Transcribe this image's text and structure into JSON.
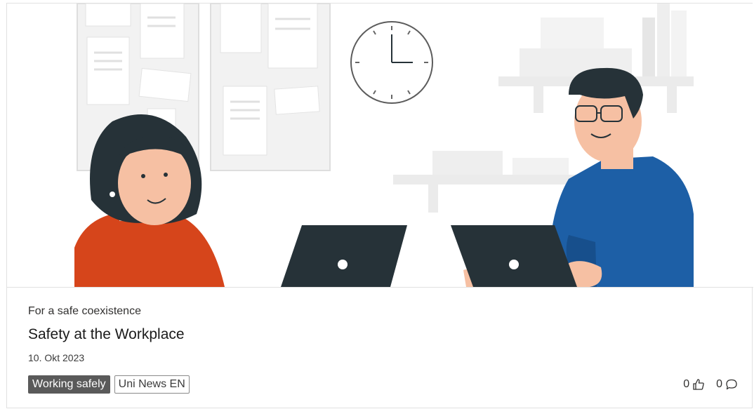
{
  "card": {
    "subtitle": "For a safe coexistence",
    "title": "Safety at the Workplace",
    "date": "10. Okt 2023",
    "tags": [
      "Working safely",
      "Uni News EN"
    ],
    "likes": {
      "count": "0",
      "icon": "thumbs-up-icon"
    },
    "comments": {
      "count": "0",
      "icon": "comment-icon"
    }
  },
  "illustration": {
    "colors": {
      "woman_sweater": "#d6451b",
      "man_shirt": "#1d5fa6",
      "laptop": "#263238",
      "skin": "#f6c0a3",
      "hair": "#263238",
      "furniture": "#ebebeb"
    }
  }
}
